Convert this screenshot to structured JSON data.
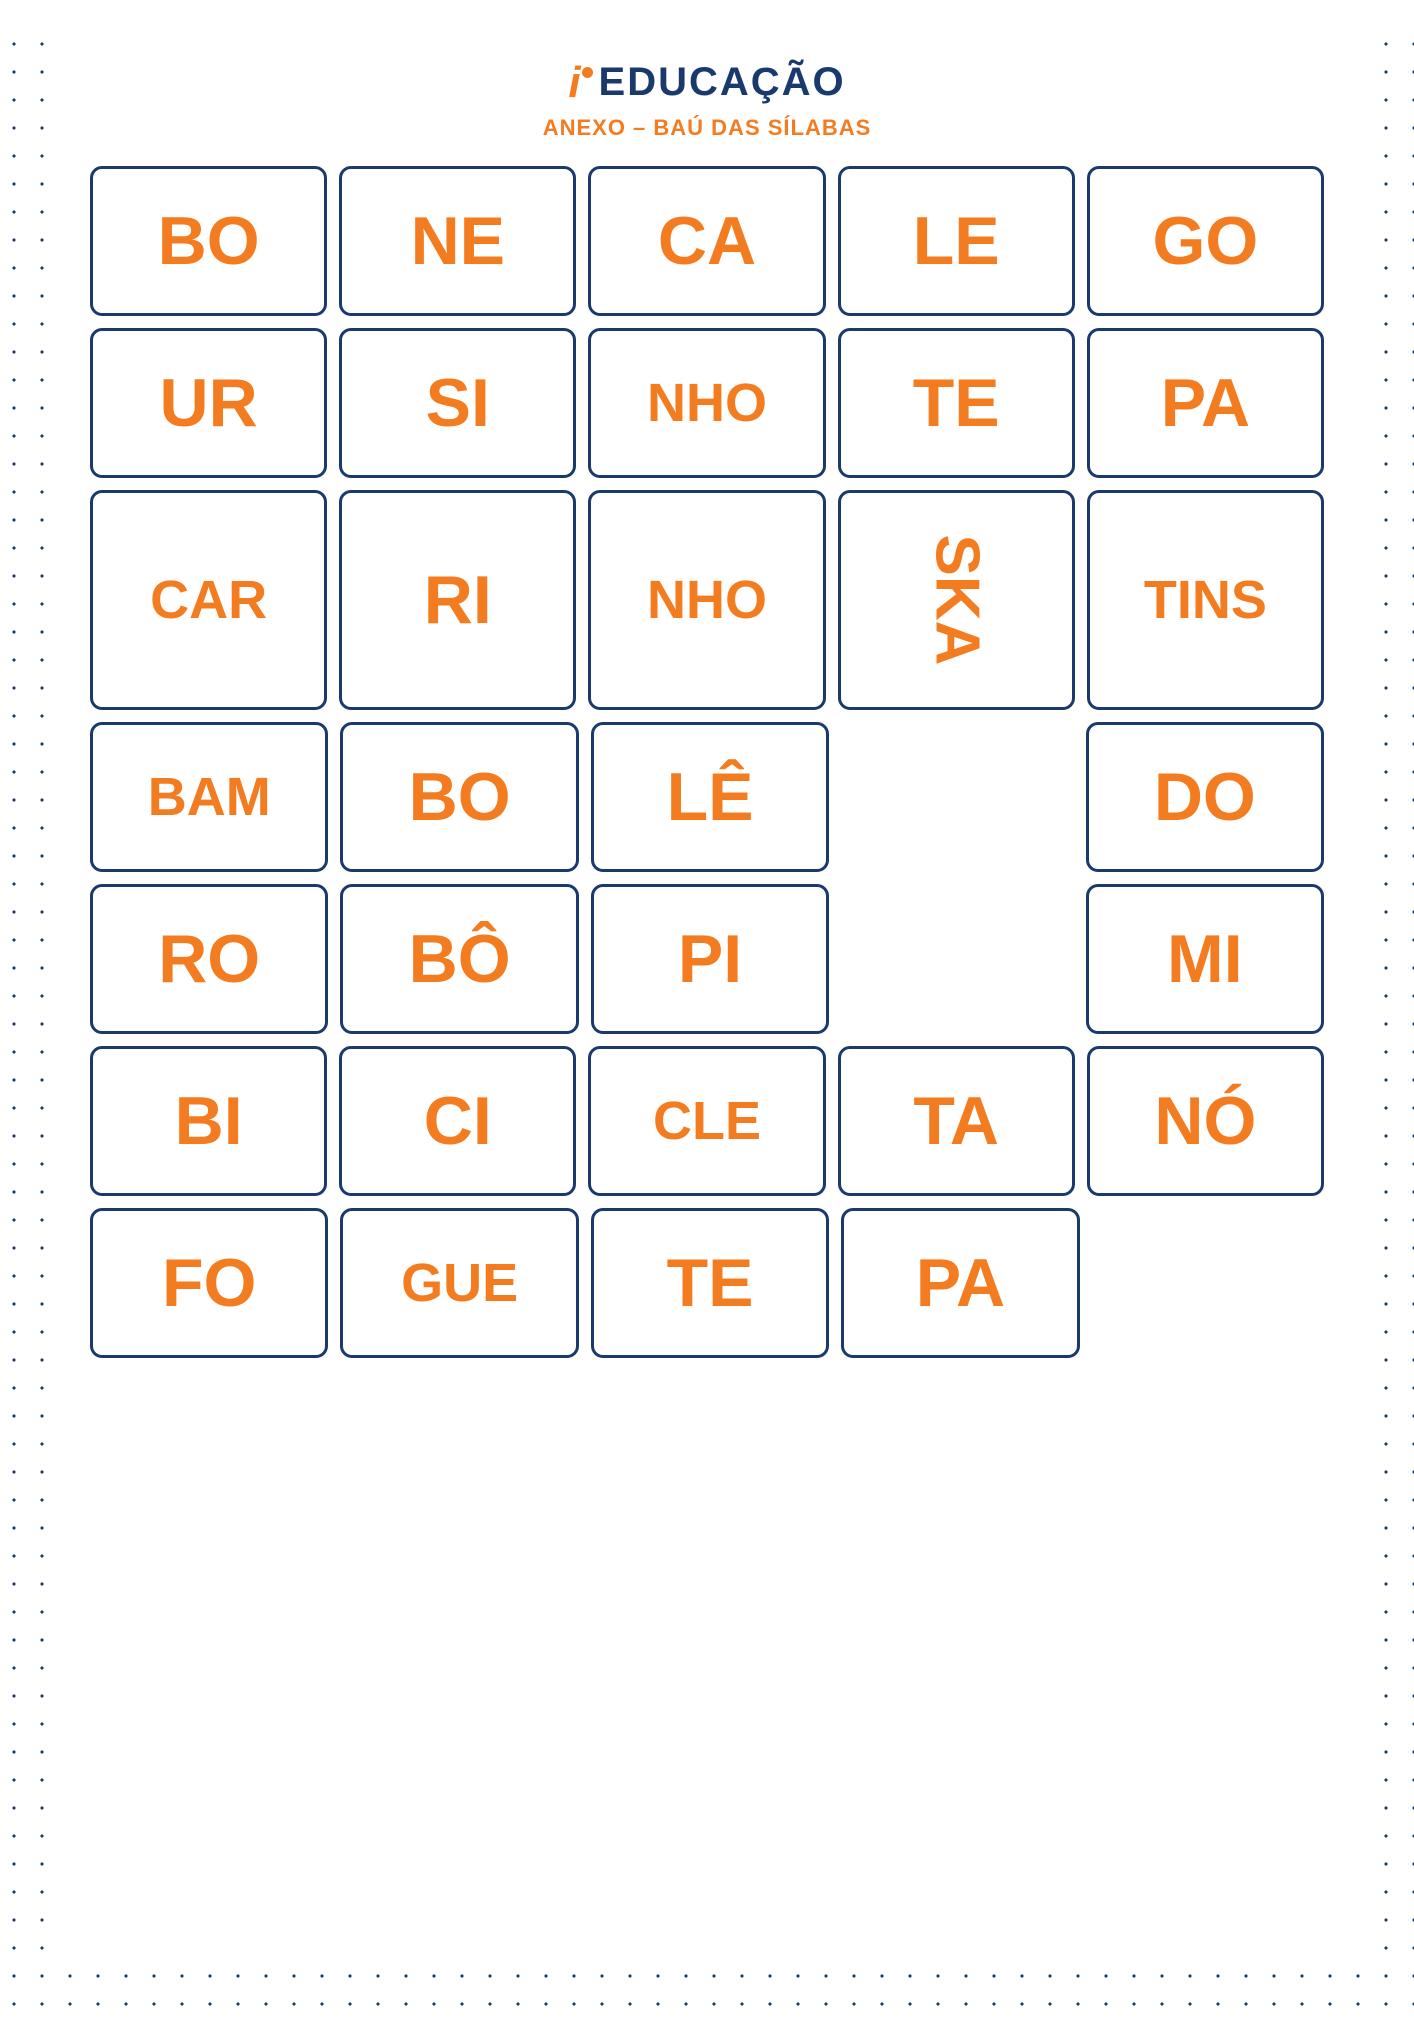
{
  "header": {
    "logo_i": "i",
    "logo_text": "EDUCAÇÃO",
    "subtitle": "ANEXO – BAÚ DAS SÍLABAS"
  },
  "rows": [
    {
      "id": "row1",
      "cards": [
        {
          "id": "bo",
          "text": "BO",
          "size": "normal"
        },
        {
          "id": "ne",
          "text": "NE",
          "size": "normal"
        },
        {
          "id": "ca",
          "text": "CA",
          "size": "normal"
        },
        {
          "id": "le",
          "text": "LE",
          "size": "normal"
        },
        {
          "id": "go",
          "text": "GO",
          "size": "normal"
        }
      ]
    },
    {
      "id": "row2",
      "cards": [
        {
          "id": "ur",
          "text": "UR",
          "size": "normal"
        },
        {
          "id": "si",
          "text": "SI",
          "size": "normal"
        },
        {
          "id": "nho1",
          "text": "NHO",
          "size": "small"
        },
        {
          "id": "te1",
          "text": "TE",
          "size": "normal"
        },
        {
          "id": "pa1",
          "text": "PA",
          "size": "normal"
        }
      ]
    },
    {
      "id": "row3",
      "cards": [
        {
          "id": "car",
          "text": "CAR",
          "size": "small"
        },
        {
          "id": "ri",
          "text": "RI",
          "size": "normal"
        },
        {
          "id": "nho2",
          "text": "NHO",
          "size": "small"
        },
        {
          "id": "ska",
          "text": "SKA",
          "size": "small",
          "rotated": true
        },
        {
          "id": "tins",
          "text": "TINS",
          "size": "small"
        }
      ]
    },
    {
      "id": "row4",
      "cards": [
        {
          "id": "bam",
          "text": "BAM",
          "size": "small"
        },
        {
          "id": "bo2",
          "text": "BO",
          "size": "normal"
        },
        {
          "id": "le2",
          "text": "LÊ",
          "size": "normal"
        },
        {
          "id": "spacer4a",
          "text": "",
          "spacer": true
        },
        {
          "id": "do",
          "text": "DO",
          "size": "normal"
        }
      ]
    },
    {
      "id": "row5",
      "cards": [
        {
          "id": "ro",
          "text": "RO",
          "size": "normal"
        },
        {
          "id": "bo3",
          "text": "BÔ",
          "size": "normal"
        },
        {
          "id": "pi",
          "text": "PI",
          "size": "normal"
        },
        {
          "id": "spacer5a",
          "text": "",
          "spacer": true
        },
        {
          "id": "mi",
          "text": "MI",
          "size": "normal"
        }
      ]
    },
    {
      "id": "row6",
      "cards": [
        {
          "id": "bi",
          "text": "BI",
          "size": "normal"
        },
        {
          "id": "ci",
          "text": "CI",
          "size": "normal"
        },
        {
          "id": "cle",
          "text": "CLE",
          "size": "small"
        },
        {
          "id": "ta",
          "text": "TA",
          "size": "normal"
        },
        {
          "id": "no",
          "text": "NÓ",
          "size": "normal"
        }
      ]
    },
    {
      "id": "row7",
      "cards": [
        {
          "id": "fo",
          "text": "FO",
          "size": "normal"
        },
        {
          "id": "gue",
          "text": "GUE",
          "size": "small"
        },
        {
          "id": "te2",
          "text": "TE",
          "size": "normal"
        },
        {
          "id": "pa2",
          "text": "PA",
          "size": "normal"
        },
        {
          "id": "spacer7a",
          "text": "",
          "spacer": true
        }
      ]
    }
  ],
  "colors": {
    "orange": "#f47c20",
    "navy": "#1a3a6e",
    "bg": "white"
  }
}
